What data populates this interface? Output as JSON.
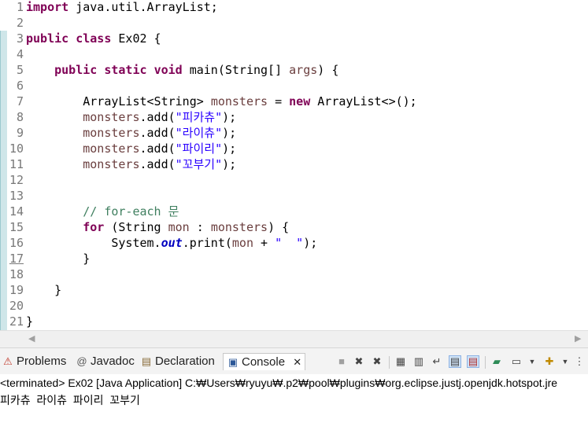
{
  "editor": {
    "lines": [
      {
        "n": "1",
        "segs": [
          {
            "t": "import",
            "c": "kw"
          },
          {
            "t": " java.util.ArrayList;",
            "c": ""
          }
        ]
      },
      {
        "n": "2",
        "segs": []
      },
      {
        "n": "3",
        "segs": [
          {
            "t": "public",
            "c": "kw"
          },
          {
            "t": " ",
            "c": ""
          },
          {
            "t": "class",
            "c": "kw"
          },
          {
            "t": " Ex02 {",
            "c": ""
          }
        ]
      },
      {
        "n": "4",
        "segs": []
      },
      {
        "n": "5",
        "segs": [
          {
            "t": "    ",
            "c": ""
          },
          {
            "t": "public",
            "c": "kw"
          },
          {
            "t": " ",
            "c": ""
          },
          {
            "t": "static",
            "c": "kw"
          },
          {
            "t": " ",
            "c": ""
          },
          {
            "t": "void",
            "c": "kw"
          },
          {
            "t": " main(String[] ",
            "c": ""
          },
          {
            "t": "args",
            "c": "par"
          },
          {
            "t": ") {",
            "c": ""
          }
        ]
      },
      {
        "n": "6",
        "segs": []
      },
      {
        "n": "7",
        "segs": [
          {
            "t": "        ArrayList<String> ",
            "c": ""
          },
          {
            "t": "monsters",
            "c": "vr"
          },
          {
            "t": " = ",
            "c": ""
          },
          {
            "t": "new",
            "c": "kw"
          },
          {
            "t": " ArrayList<>();",
            "c": ""
          }
        ]
      },
      {
        "n": "8",
        "segs": [
          {
            "t": "        ",
            "c": ""
          },
          {
            "t": "monsters",
            "c": "vr"
          },
          {
            "t": ".add(",
            "c": ""
          },
          {
            "t": "\"피카츄\"",
            "c": "str"
          },
          {
            "t": ");",
            "c": ""
          }
        ]
      },
      {
        "n": "9",
        "segs": [
          {
            "t": "        ",
            "c": ""
          },
          {
            "t": "monsters",
            "c": "vr"
          },
          {
            "t": ".add(",
            "c": ""
          },
          {
            "t": "\"라이츄\"",
            "c": "str"
          },
          {
            "t": ");",
            "c": ""
          }
        ]
      },
      {
        "n": "10",
        "segs": [
          {
            "t": "        ",
            "c": ""
          },
          {
            "t": "monsters",
            "c": "vr"
          },
          {
            "t": ".add(",
            "c": ""
          },
          {
            "t": "\"파이리\"",
            "c": "str"
          },
          {
            "t": ");",
            "c": ""
          }
        ]
      },
      {
        "n": "11",
        "segs": [
          {
            "t": "        ",
            "c": ""
          },
          {
            "t": "monsters",
            "c": "vr"
          },
          {
            "t": ".add(",
            "c": ""
          },
          {
            "t": "\"꼬부기\"",
            "c": "str"
          },
          {
            "t": ");",
            "c": ""
          }
        ]
      },
      {
        "n": "12",
        "segs": []
      },
      {
        "n": "13",
        "segs": []
      },
      {
        "n": "14",
        "segs": [
          {
            "t": "        ",
            "c": ""
          },
          {
            "t": "// for-each 문",
            "c": "cmt"
          }
        ]
      },
      {
        "n": "15",
        "segs": [
          {
            "t": "        ",
            "c": ""
          },
          {
            "t": "for",
            "c": "kw"
          },
          {
            "t": " (String ",
            "c": ""
          },
          {
            "t": "mon",
            "c": "vr"
          },
          {
            "t": " : ",
            "c": ""
          },
          {
            "t": "monsters",
            "c": "vr"
          },
          {
            "t": ") {",
            "c": ""
          }
        ]
      },
      {
        "n": "16",
        "segs": [
          {
            "t": "            System.",
            "c": ""
          },
          {
            "t": "out",
            "c": "fld"
          },
          {
            "t": ".print(",
            "c": ""
          },
          {
            "t": "mon",
            "c": "vr"
          },
          {
            "t": " + ",
            "c": ""
          },
          {
            "t": "\"  \"",
            "c": "str"
          },
          {
            "t": ");",
            "c": ""
          }
        ]
      },
      {
        "n": "17",
        "segs": [
          {
            "t": "        }",
            "c": ""
          }
        ]
      },
      {
        "n": "18",
        "segs": []
      },
      {
        "n": "19",
        "segs": [
          {
            "t": "    }",
            "c": ""
          }
        ]
      },
      {
        "n": "20",
        "segs": []
      },
      {
        "n": "21",
        "segs": [
          {
            "t": "}",
            "c": ""
          }
        ]
      }
    ]
  },
  "scroll": {
    "left_arrow": "◀",
    "right_arrow": "▶"
  },
  "views": {
    "problems": {
      "label": "Problems",
      "icon": "problems-icon"
    },
    "javadoc": {
      "label": "Javadoc",
      "icon": "javadoc-icon"
    },
    "declaration": {
      "label": "Declaration",
      "icon": "declaration-icon"
    },
    "console": {
      "label": "Console",
      "icon": "console-icon",
      "close": "✕"
    }
  },
  "toolbar_icons": [
    "terminate-icon",
    "remove-launch-icon",
    "remove-all-icon",
    "clear-console-icon",
    "scroll-lock-icon",
    "word-wrap-icon",
    "show-on-stdout-icon",
    "show-on-stderr-icon",
    "pin-console-icon",
    "display-console-icon",
    "open-console-icon",
    "view-menu-icon"
  ],
  "console": {
    "status": "<terminated> Ex02 [Java Application] C:₩Users₩ryuyu₩.p2₩pool₩plugins₩org.eclipse.justj.openjdk.hotspot.jre",
    "output": "피카츄  라이츄  파이리  꼬부기"
  },
  "colors": {
    "keyword": "#7f0055",
    "string": "#2a00ff",
    "comment": "#3f7f5f",
    "field": "#0000c0",
    "variable": "#6a3e3e",
    "line_number": "#787878"
  }
}
